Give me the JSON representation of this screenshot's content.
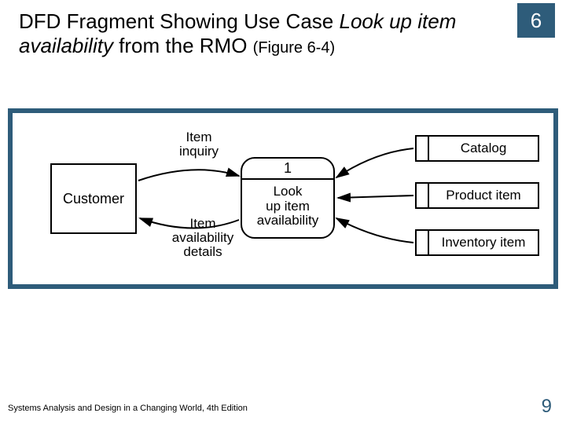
{
  "chapter_number": "6",
  "title": {
    "prefix": "DFD Fragment Showing Use Case ",
    "italic": "Look up item availability",
    "suffix": " from the RMO ",
    "figref": "(Figure 6-4)"
  },
  "diagram": {
    "external_entity": "Customer",
    "process": {
      "number": "1",
      "label_line1": "Look",
      "label_line2": "up item",
      "label_line3": "availability"
    },
    "datastores": {
      "d1": "Catalog",
      "d2": "Product item",
      "d3": "Inventory item"
    },
    "flows": {
      "inquiry_line1": "Item",
      "inquiry_line2": "inquiry",
      "details_line1": "Item",
      "details_line2": "availability",
      "details_line3": "details"
    }
  },
  "footer": {
    "book": "Systems Analysis and Design in a Changing World, 4th Edition",
    "page": "9"
  }
}
